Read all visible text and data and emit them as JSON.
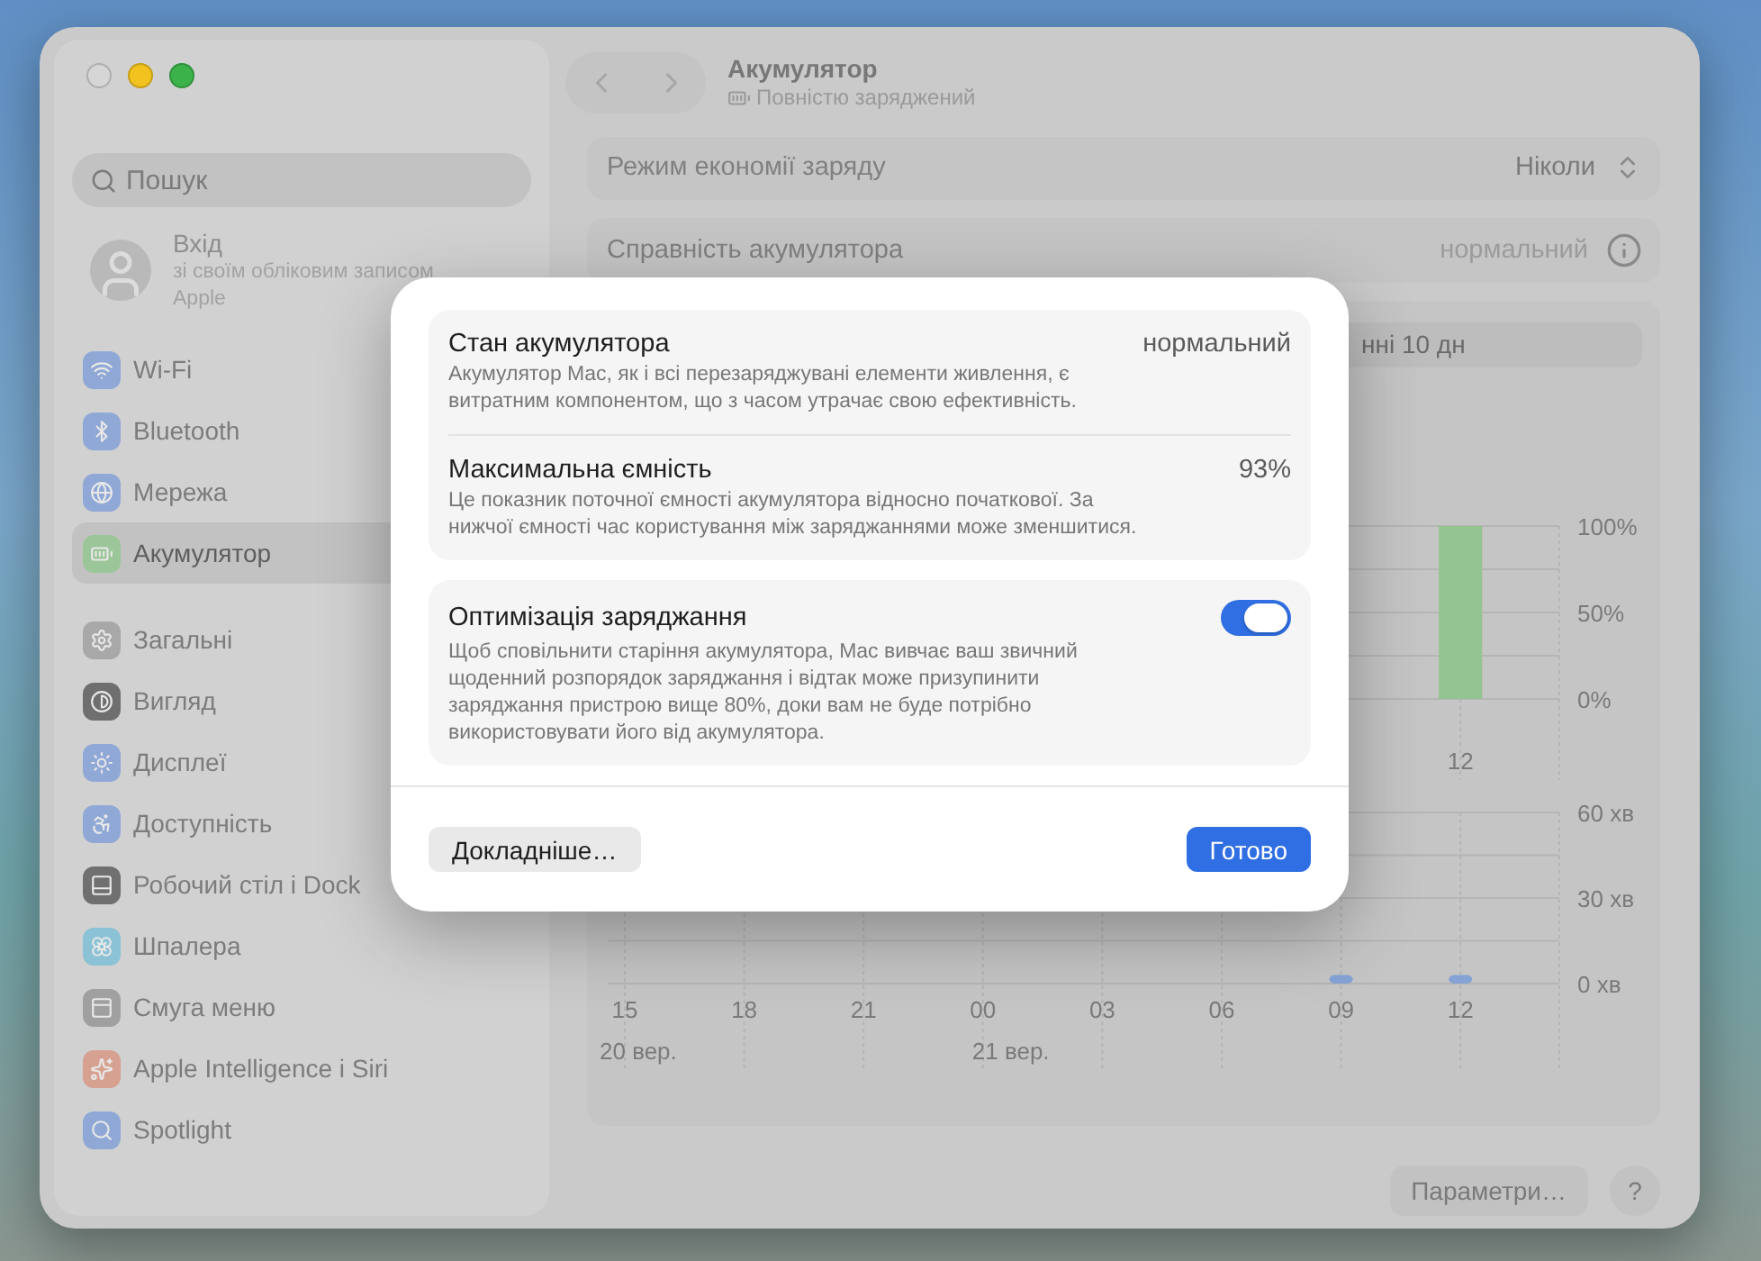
{
  "window": {
    "traffic_lights": [
      {
        "color": "#d6d6d6"
      },
      {
        "color": "#f2c21e"
      },
      {
        "color": "#3cb34a"
      }
    ]
  },
  "sidebar": {
    "search": {
      "placeholder": "Пошук"
    },
    "account": {
      "title": "Вхід",
      "subtitle": "зі своїм обліковим записом Apple"
    },
    "sections": [
      {
        "items": [
          {
            "label": "Wi-Fi",
            "color": "#8fa8d6",
            "selected": false
          },
          {
            "label": "Bluetooth",
            "color": "#8fa8d6",
            "selected": false
          },
          {
            "label": "Мережа",
            "color": "#8fa8d6",
            "selected": false
          },
          {
            "label": "Акумулятор",
            "color": "#9bc699",
            "selected": true
          }
        ]
      },
      {
        "items": [
          {
            "label": "Загальні",
            "color": "#a8a8a8",
            "selected": false
          },
          {
            "label": "Вигляд",
            "color": "#6f6f6f",
            "selected": false
          },
          {
            "label": "Дисплеї",
            "color": "#8fa8d6",
            "selected": false
          },
          {
            "label": "Доступність",
            "color": "#8fa8d6",
            "selected": false
          },
          {
            "label": "Робочий стіл і Dock",
            "color": "#707070",
            "selected": false
          },
          {
            "label": "Шпалера",
            "color": "#8cc2d6",
            "selected": false
          },
          {
            "label": "Смуга меню",
            "color": "#a0a0a0",
            "selected": false
          },
          {
            "label": "Apple Intelligence і Siri",
            "color": "#d6a191",
            "selected": false
          },
          {
            "label": "Spotlight",
            "color": "#8fa8d6",
            "selected": false
          }
        ]
      }
    ]
  },
  "header": {
    "title": "Акумулятор",
    "status": "Повністю заряджений"
  },
  "settings": [
    {
      "kind": "select",
      "label": "Режим економії заряду",
      "value": "Ніколи"
    },
    {
      "kind": "info",
      "label": "Справність акумулятора",
      "value": "нормальний"
    }
  ],
  "usage": {
    "range_label": "нні 10 дн",
    "charge_chart": {
      "chart_data": {
        "type": "bar",
        "values": [
          100
        ],
        "ylim": [
          0,
          100
        ],
        "yticks": [
          {
            "value": 0,
            "label": "0%"
          },
          {
            "value": 50,
            "label": "50%"
          },
          {
            "value": 100,
            "label": "100%"
          }
        ],
        "grid": true,
        "annotations": [
          "12"
        ]
      }
    },
    "usage_chart": {
      "chart_data": {
        "type": "bar",
        "categories": [
          "15",
          "18",
          "21",
          "00",
          "03",
          "06",
          "09",
          "12"
        ],
        "values": [
          null,
          null,
          null,
          null,
          null,
          null,
          3,
          3
        ],
        "ylim": [
          0,
          60
        ],
        "yticks": [
          {
            "value": 0,
            "label": "0 хв"
          },
          {
            "value": 30,
            "label": "30 хв"
          },
          {
            "value": 60,
            "label": "60 хв"
          }
        ],
        "grid": true
      },
      "date_labels": [
        "20 вер.",
        "21 вер."
      ]
    }
  },
  "footer": {
    "buttons": [
      {
        "label": "Параметри…",
        "kind": "text"
      },
      {
        "label": "?",
        "kind": "help"
      }
    ]
  },
  "dialog": {
    "sections": [
      {
        "items": [
          {
            "kind": "value",
            "title": "Стан акумулятора",
            "value": "нормальний",
            "description": "Акумулятор Mac, як і всі перезаряджувані елементи живлення, є витратним компонентом, що з часом утрачає свою ефективність."
          },
          {
            "kind": "value",
            "title": "Максимальна ємність",
            "value": "93%",
            "description": "Це показник поточної ємності акумулятора відносно початкової. За нижчої ємності час користування між заряджаннями може зменшитися."
          }
        ]
      },
      {
        "items": [
          {
            "kind": "toggle",
            "title": "Оптимізація заряджання",
            "on": true,
            "description": "Щоб сповільнити старіння акумулятора, Mac вивчає ваш звичний щоденний розпорядок заряджання і відтак може призупинити заряджання пристрою вище 80%, доки вам не буде потрібно використовувати його від акумулятора."
          }
        ]
      }
    ],
    "buttons": [
      {
        "label": "Докладніше…",
        "kind": "secondary"
      },
      {
        "label": "Готово",
        "kind": "primary"
      }
    ]
  }
}
